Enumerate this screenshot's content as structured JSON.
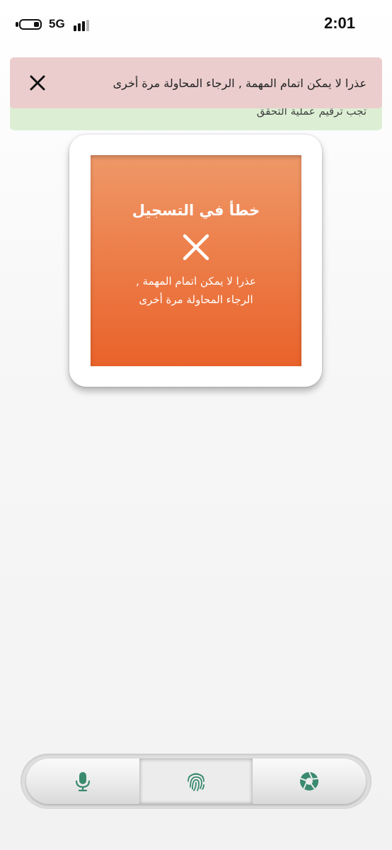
{
  "status_bar": {
    "network": "5G",
    "time": "2:01"
  },
  "notice": {
    "text": "تجب ترقيم عملية التحقق"
  },
  "toast": {
    "message": "عذرا لا يمكن اتمام المهمة , الرجاء المحاولة مرة أخرى",
    "close_icon": "close-icon"
  },
  "card": {
    "title": "خطأ في التسجيل",
    "message_line1": "عذرا لا يمكن اتمام المهمة ,",
    "message_line2": "الرجاء المحاولة مرة أخرى",
    "icon": "error-x-icon"
  },
  "bottom_nav": {
    "items": [
      {
        "icon": "microphone-icon",
        "selected": false
      },
      {
        "icon": "fingerprint-icon",
        "selected": true
      },
      {
        "icon": "camera-aperture-icon",
        "selected": false
      }
    ]
  },
  "colors": {
    "toast_bg": "#ebcdcd",
    "notice_bg": "#dcefd4",
    "card_gradient_top": "#ef9868",
    "card_gradient_bottom": "#e9622b",
    "icon_green": "#3a8a6e"
  }
}
